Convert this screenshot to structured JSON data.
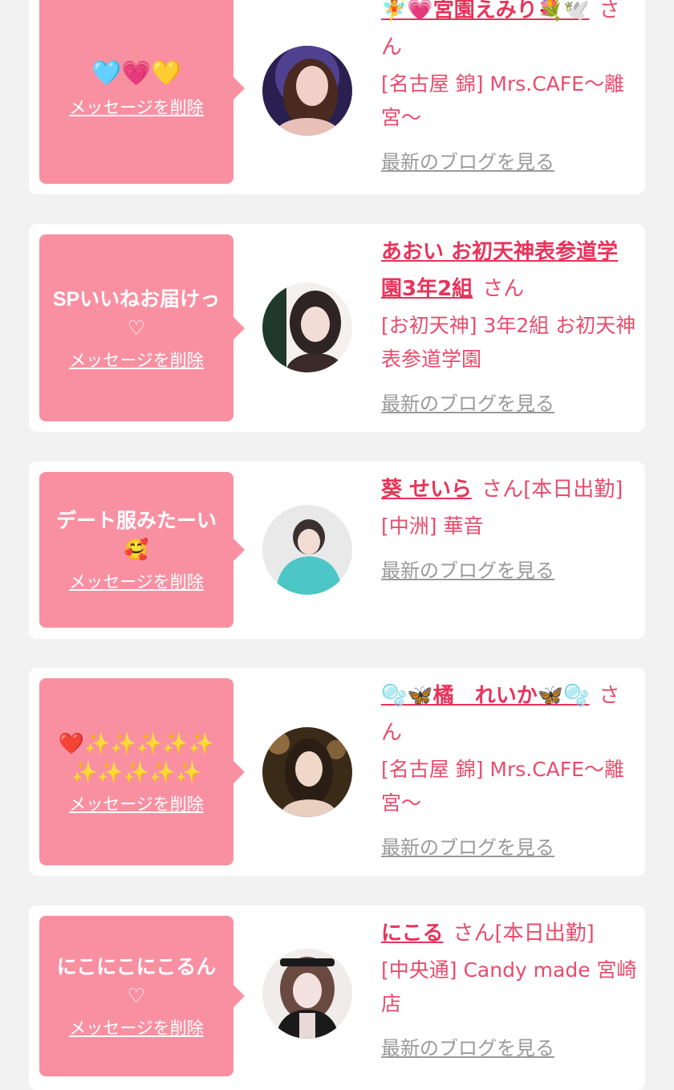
{
  "items": [
    {
      "message": "🩵💗💛",
      "delete_label": "メッセージを削除",
      "name": "🧚💗宮園えみり💐🕊️",
      "suffix": "さん",
      "shop": "[名古屋 錦] Mrs.CAFE〜離宮〜",
      "blog_link": "最新のブログを見る",
      "avatar_colors": [
        "#2a2050",
        "#6a5ab8",
        "#e8c8c0"
      ]
    },
    {
      "message": "SPいいねお届けっ♡",
      "delete_label": "メッセージを削除",
      "name": "あおい お初天神表参道学園3年2組",
      "suffix": "さん",
      "shop": "[お初天神] 3年2組 お初天神表参道学園",
      "blog_link": "最新のブログを見る",
      "avatar_colors": [
        "#1f3a2a",
        "#e8e0dc",
        "#3a2a2a"
      ]
    },
    {
      "message": "デート服みたーい🥰",
      "delete_label": "メッセージを削除",
      "name": "葵 せいら",
      "suffix": "さん[本日出勤]",
      "shop": "[中洲] 華音",
      "blog_link": "最新のブログを見る",
      "avatar_colors": [
        "#e9e9e9",
        "#4cc6c6",
        "#3a3030"
      ]
    },
    {
      "message": "❤️✨✨✨✨✨✨✨✨✨✨",
      "delete_label": "メッセージを削除",
      "name": "🫧🦋橘　れいか🦋🫧",
      "suffix": "さん",
      "shop": "[名古屋 錦] Mrs.CAFE〜離宮〜",
      "blog_link": "最新のブログを見る",
      "avatar_colors": [
        "#3a2a18",
        "#c89a5a",
        "#f0d8c8"
      ]
    },
    {
      "message": "にこにこにこるん♡",
      "delete_label": "メッセージを削除",
      "name": "にこる",
      "suffix": "さん[本日出勤]",
      "shop": "[中央通] Candy made 宮崎店",
      "blog_link": "最新のブログを見る",
      "avatar_colors": [
        "#f0ecec",
        "#1a1a1a",
        "#e8d8d8"
      ]
    }
  ]
}
